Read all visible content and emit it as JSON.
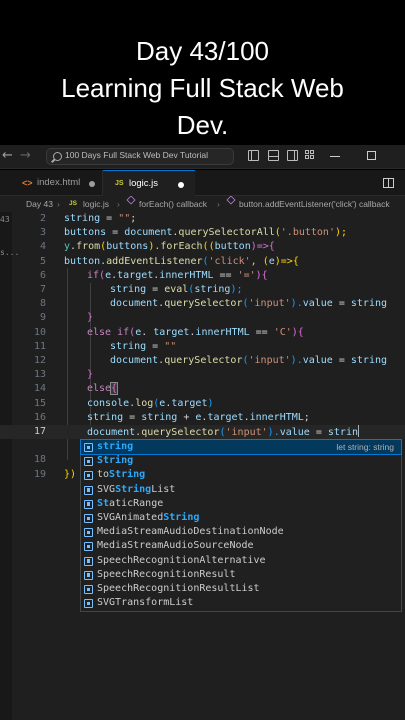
{
  "caption": {
    "line1": "Day 43/100",
    "line2": "Learning Full Stack Web",
    "line3": "Dev."
  },
  "titlebar": {
    "search_text": "100 Days Full Stack Web Dev Tutorial",
    "back_icon": "arrow-left-icon",
    "forward_icon": "arrow-right-icon"
  },
  "tabs": [
    {
      "label": "index.html",
      "icon": "<>",
      "unsaved": true
    },
    {
      "label": "logic.js",
      "icon": "JS",
      "unsaved": true,
      "active": true
    }
  ],
  "breadcrumb": {
    "folder": "Day 43",
    "file_icon": "JS",
    "file": "logic.js",
    "item1": "forEach() callback",
    "item2": "button.addEventListener('click') callback"
  },
  "left_gutter": {
    "mark1": "43",
    "mark2": "s..."
  },
  "editor": {
    "line_numbers": [
      "2",
      "3",
      "4",
      "5",
      "6",
      "7",
      "8",
      "9",
      "10",
      "11",
      "12",
      "13",
      "14",
      "15",
      "16",
      "17",
      "18",
      "19"
    ],
    "current_line": "16"
  },
  "code": {
    "l2_a": "string",
    "l2_b": " = ",
    "l2_c": "\"\"",
    "l2_d": ";",
    "l3_a": "buttons",
    "l3_b": " = ",
    "l3_c": "document",
    "l3_d": ".",
    "l3_e": "querySelectorAll",
    "l3_f": "(",
    "l3_g": "'.button'",
    "l3_h": ");",
    "l4_a": "y",
    "l4_b": ".",
    "l4_c": "from",
    "l4_d": "(",
    "l4_e": "buttons",
    "l4_f": ").",
    "l4_g": "forEach",
    "l4_h": "((",
    "l4_i": "button",
    "l4_j": ")=>",
    "l4_k": "{",
    "l5_a": "button",
    "l5_b": ".",
    "l5_c": "addEventListener",
    "l5_d": "(",
    "l5_e": "'click'",
    "l5_f": ", (",
    "l5_g": "e",
    "l5_h": ")=>",
    "l5_i": "{",
    "l6_a": "if",
    "l6_b": "(",
    "l6_c": "e",
    "l6_d": ".",
    "l6_e": "target",
    "l6_f": ".",
    "l6_g": "innerHTML",
    "l6_h": " == ",
    "l6_i": "'='",
    "l6_j": "){",
    "l7_a": "string",
    "l7_b": " = ",
    "l7_c": "eval",
    "l7_d": "(",
    "l7_e": "string",
    "l7_f": ");",
    "l8_a": "document",
    "l8_b": ".",
    "l8_c": "querySelector",
    "l8_d": "(",
    "l8_e": "'input'",
    "l8_f": ").",
    "l8_g": "value",
    "l8_h": " = ",
    "l8_i": "string",
    "l9_a": "}",
    "l10_a": "else ",
    "l10_b": "if",
    "l10_c": "(",
    "l10_d": "e",
    "l10_e": ". ",
    "l10_f": "target",
    "l10_g": ".",
    "l10_h": "innerHTML",
    "l10_i": " == ",
    "l10_j": "'C'",
    "l10_k": "){",
    "l11_a": "string",
    "l11_b": " = ",
    "l11_c": "\"\"",
    "l12_a": "document",
    "l12_b": ".",
    "l12_c": "querySelector",
    "l12_d": "(",
    "l12_e": "'input'",
    "l12_f": ").",
    "l12_g": "value",
    "l12_h": " = ",
    "l12_i": "string",
    "l13_a": "}",
    "l14_a": "else",
    "l14_b": "{",
    "l15_a": "console",
    "l15_b": ".",
    "l15_c": "log",
    "l15_d": "(",
    "l15_e": "e",
    "l15_f": ".",
    "l15_g": "target",
    "l15_h": ")",
    "l16_a": "string",
    "l16_b": " = ",
    "l16_c": "string",
    "l16_d": " + ",
    "l16_e": "e",
    "l16_f": ".",
    "l16_g": "target",
    "l16_h": ".",
    "l16_i": "innerHTML",
    "l16_j": ";",
    "l17_a": "document",
    "l17_b": ".",
    "l17_c": "querySelector",
    "l17_d": "(",
    "l17_e": "'input'",
    "l17_f": ").",
    "l17_g": "value",
    "l17_h": " = ",
    "l17_i": "strin",
    "l18_a": "}",
    "l19_a": "})",
    "l19_b": " ",
    "l19_c": "}"
  },
  "suggestions": {
    "selected_detail": "let string: string",
    "items": [
      {
        "pre": "",
        "match": "string",
        "post": ""
      },
      {
        "pre": "",
        "match": "String",
        "post": ""
      },
      {
        "pre": "to",
        "match": "String",
        "post": ""
      },
      {
        "pre": "SVG",
        "match": "String",
        "post": "List"
      },
      {
        "pre": "",
        "match": "St",
        "post": "aticRange"
      },
      {
        "pre": "SVGAnimated",
        "match": "String",
        "post": ""
      },
      {
        "pre": "MediaStreamAudioDestinationNode",
        "match": "",
        "post": ""
      },
      {
        "pre": "MediaStreamAudioSourceNode",
        "match": "",
        "post": ""
      },
      {
        "pre": "SpeechRecognitionAlternative",
        "match": "",
        "post": ""
      },
      {
        "pre": "SpeechRecognitionResult",
        "match": "",
        "post": ""
      },
      {
        "pre": "SpeechRecognitionResultList",
        "match": "",
        "post": ""
      },
      {
        "pre": "SVGTransformList",
        "match": "",
        "post": ""
      }
    ]
  }
}
